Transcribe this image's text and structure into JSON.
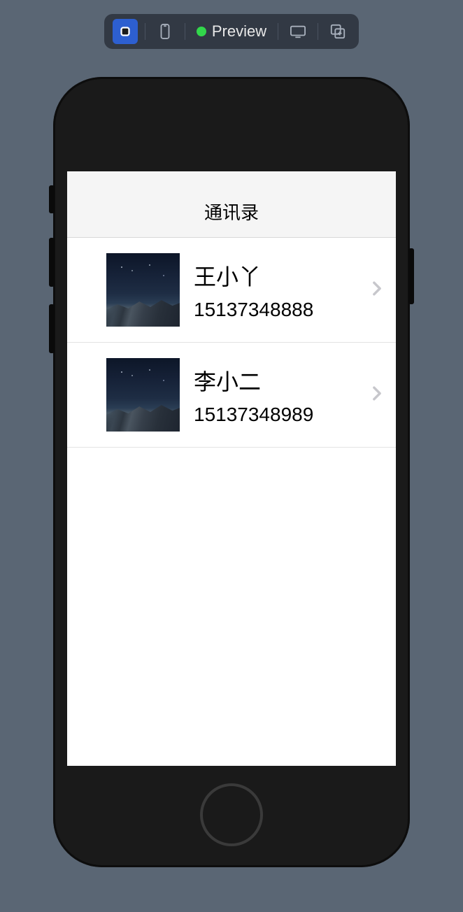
{
  "toolbar": {
    "preview_label": "Preview"
  },
  "app": {
    "nav_title": "通讯录"
  },
  "contacts": [
    {
      "name": "王小丫",
      "phone": "15137348888"
    },
    {
      "name": "李小二",
      "phone": "15137348989"
    }
  ]
}
